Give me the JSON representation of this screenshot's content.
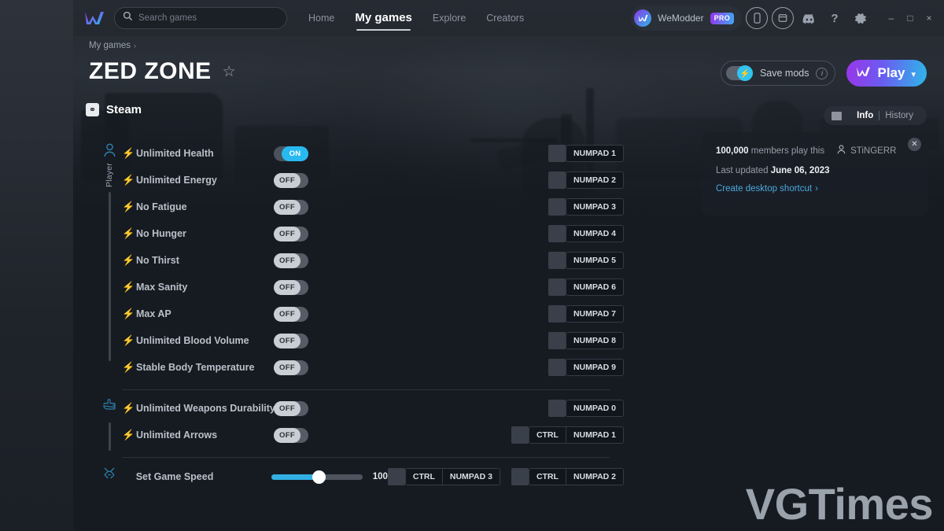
{
  "titlebar": {
    "logo_icon": "wemod-logo-icon",
    "search": {
      "placeholder": "Search games",
      "value": "",
      "icon": "search-icon"
    },
    "nav": [
      {
        "label": "Home",
        "active": false
      },
      {
        "label": "My games",
        "active": true
      },
      {
        "label": "Explore",
        "active": false
      },
      {
        "label": "Creators",
        "active": false
      }
    ],
    "account": {
      "name": "WeModder",
      "badge": "PRO",
      "avatar_icon": "wemod-avatar-icon"
    },
    "icons": [
      "phone-icon",
      "window-icon",
      "discord-icon",
      "help-icon",
      "gear-icon"
    ],
    "window_controls": {
      "minimize": "–",
      "maximize": "□",
      "close": "×"
    }
  },
  "breadcrumb": {
    "label": "My games",
    "chevron": "›"
  },
  "game": {
    "title": "ZED ZONE",
    "favorite_icon": "star-icon"
  },
  "actions": {
    "save_mods": {
      "label": "Save mods",
      "state": "on",
      "toggle_icon": "bolt-icon",
      "info_icon": "info-icon"
    },
    "play": {
      "label": "Play",
      "caret": "⌄",
      "icon": "wemod-logo-icon"
    }
  },
  "platform": {
    "name": "Steam",
    "icon": "steam-icon"
  },
  "info_tabs": {
    "flag_icon": "flag-icon",
    "tabs": [
      {
        "label": "Info",
        "active": true
      },
      {
        "label": "History",
        "active": false
      }
    ]
  },
  "info_panel": {
    "close_icon": "close-icon",
    "members_count": "100,000",
    "members_suffix": "members play this",
    "author_icon": "person-icon",
    "author": "STiNGERR",
    "updated_label": "Last updated",
    "updated_date": "June 06, 2023",
    "shortcut_link": "Create desktop shortcut",
    "shortcut_chevron": "›"
  },
  "groups": [
    {
      "label": "Player",
      "icon": "person-icon",
      "rows": [
        {
          "name": "Unlimited Health",
          "bolt": true,
          "toggle": "ON",
          "keys": [
            [
              "NUMPAD 1"
            ]
          ]
        },
        {
          "name": "Unlimited Energy",
          "bolt": true,
          "toggle": "OFF",
          "keys": [
            [
              "NUMPAD 2"
            ]
          ]
        },
        {
          "name": "No Fatigue",
          "bolt": true,
          "toggle": "OFF",
          "keys": [
            [
              "NUMPAD 3"
            ]
          ]
        },
        {
          "name": "No Hunger",
          "bolt": true,
          "toggle": "OFF",
          "keys": [
            [
              "NUMPAD 4"
            ]
          ]
        },
        {
          "name": "No Thirst",
          "bolt": true,
          "toggle": "OFF",
          "keys": [
            [
              "NUMPAD 5"
            ]
          ]
        },
        {
          "name": "Max Sanity",
          "bolt": true,
          "toggle": "OFF",
          "keys": [
            [
              "NUMPAD 6"
            ]
          ]
        },
        {
          "name": "Max AP",
          "bolt": true,
          "toggle": "OFF",
          "keys": [
            [
              "NUMPAD 7"
            ]
          ]
        },
        {
          "name": "Unlimited Blood Volume",
          "bolt": true,
          "toggle": "OFF",
          "keys": [
            [
              "NUMPAD 8"
            ]
          ]
        },
        {
          "name": "Stable Body Temperature",
          "bolt": true,
          "toggle": "OFF",
          "keys": [
            [
              "NUMPAD 9"
            ]
          ]
        }
      ]
    },
    {
      "label": "",
      "icon": "pointing-hand-icon",
      "rows": [
        {
          "name": "Unlimited Weapons Durability",
          "bolt": true,
          "toggle": "OFF",
          "keys": [
            [
              "NUMPAD 0"
            ]
          ]
        },
        {
          "name": "Unlimited Arrows",
          "bolt": true,
          "toggle": "OFF",
          "keys": [
            [
              "CTRL",
              "NUMPAD 1"
            ]
          ]
        }
      ]
    },
    {
      "label": "",
      "icon": "game-misc-icon",
      "rows": [
        {
          "name": "Set Game Speed",
          "bolt": false,
          "slider": {
            "value": "100",
            "percent": 52
          },
          "keys": [
            [
              "CTRL",
              "NUMPAD 3"
            ],
            [
              "CTRL",
              "NUMPAD 2"
            ]
          ]
        }
      ]
    }
  ],
  "watermark": "VGTimes",
  "colors": {
    "accent_cyan": "#28b9f0",
    "bolt_blue": "#2ea9e8",
    "play_gradient_from": "#9a35ea",
    "play_gradient_to": "#2fb6ea",
    "link_blue": "#4aa8e0",
    "window_bg": "#161b22",
    "toggle_off_track": "#555c66",
    "toggle_off_pill": "#c9ced5"
  }
}
